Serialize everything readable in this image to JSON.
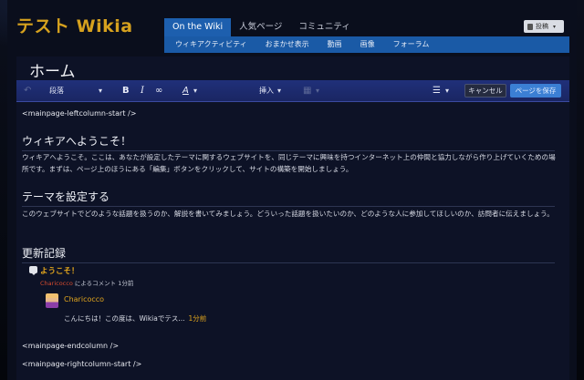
{
  "header": {
    "logo": "テスト Wikia",
    "tabs": [
      "On the Wiki",
      "人気ページ",
      "コミュニティ"
    ],
    "subnav": [
      "ウィキアクティビティ",
      "おまかせ表示",
      "動画",
      "画像",
      "フォーラム"
    ],
    "contribute_label": "投稿"
  },
  "article": {
    "title": "ホーム",
    "toolbar": {
      "format_select": "段落",
      "bold": "B",
      "italic": "I",
      "link": "∞",
      "text_color": "A",
      "insert_menu": "挿入",
      "table_icon": "▦",
      "list_icon": "☰",
      "undo_icon": "↶",
      "cancel": "キャンセル",
      "save": "ページを保存"
    },
    "content": {
      "tag_left_start": "<mainpage-leftcolumn-start />",
      "welcome_heading": "ウィキアへようこそ！",
      "welcome_text": "ウィキアへようこそ。ここは、あなたが設定したテーマに関するウェブサイトを、同じテーマに興味を持つインターネット上の仲間と協力しながら作り上げていくための場所です。まずは、ページ上のほうにある「編集」ボタンをクリックして、サイトの構築を開始しましょう。",
      "theme_heading": "テーマを設定する",
      "theme_text": "このウェブサイトでどのような話題を扱うのか、解説を書いてみましょう。どういった話題を扱いたいのか、どのような人に参加してほしいのか、訪問者に伝えましょう。",
      "updates_heading": "更新記録",
      "activity": {
        "title": "ようこそ！",
        "user": "Charicocco",
        "meta_suffix": " によるコメント 1分前",
        "commenter": "Charicocco",
        "comment_text": "こんにちは！この度は、Wikiaでテス...",
        "comment_time": "1分前"
      },
      "tag_end_column": "<mainpage-endcolumn />",
      "tag_right_start": "<mainpage-rightcolumn-start />"
    }
  }
}
